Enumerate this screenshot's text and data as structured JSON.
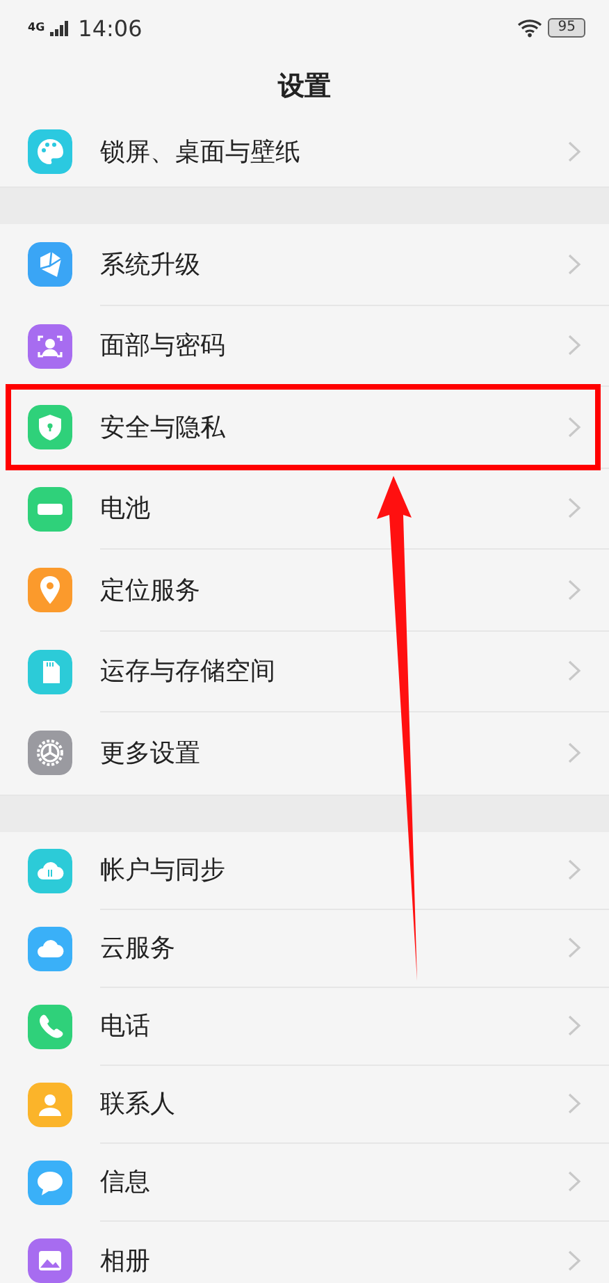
{
  "status_bar": {
    "network": "4G",
    "time": "14:06",
    "battery": "95"
  },
  "title": "设置",
  "groups": [
    {
      "items": [
        {
          "label": "锁屏、桌面与壁纸",
          "color": "#2bc9e0",
          "highlighted": false
        }
      ]
    },
    {
      "items": [
        {
          "label": "系统升级",
          "color": "#3aa5f5",
          "highlighted": false
        },
        {
          "label": "面部与密码",
          "color": "#a76cf0",
          "highlighted": false
        },
        {
          "label": "安全与隐私",
          "color": "#2fd17a",
          "highlighted": true
        },
        {
          "label": "电池",
          "color": "#2fd17a",
          "highlighted": false
        },
        {
          "label": "定位服务",
          "color": "#fb9a2c",
          "highlighted": false
        },
        {
          "label": "运存与存储空间",
          "color": "#2ccbd8",
          "highlighted": false
        },
        {
          "label": "更多设置",
          "color": "#9a9aa0",
          "highlighted": false
        }
      ]
    },
    {
      "items": [
        {
          "label": "帐户与同步",
          "color": "#2ccbd8",
          "highlighted": false
        },
        {
          "label": "云服务",
          "color": "#3ab0f8",
          "highlighted": false
        },
        {
          "label": "电话",
          "color": "#2fd17a",
          "highlighted": false
        },
        {
          "label": "联系人",
          "color": "#fbb42a",
          "highlighted": false
        },
        {
          "label": "信息",
          "color": "#3ab0f8",
          "highlighted": false
        },
        {
          "label": "相册",
          "color": "#a76cf0",
          "highlighted": false
        }
      ]
    }
  ]
}
